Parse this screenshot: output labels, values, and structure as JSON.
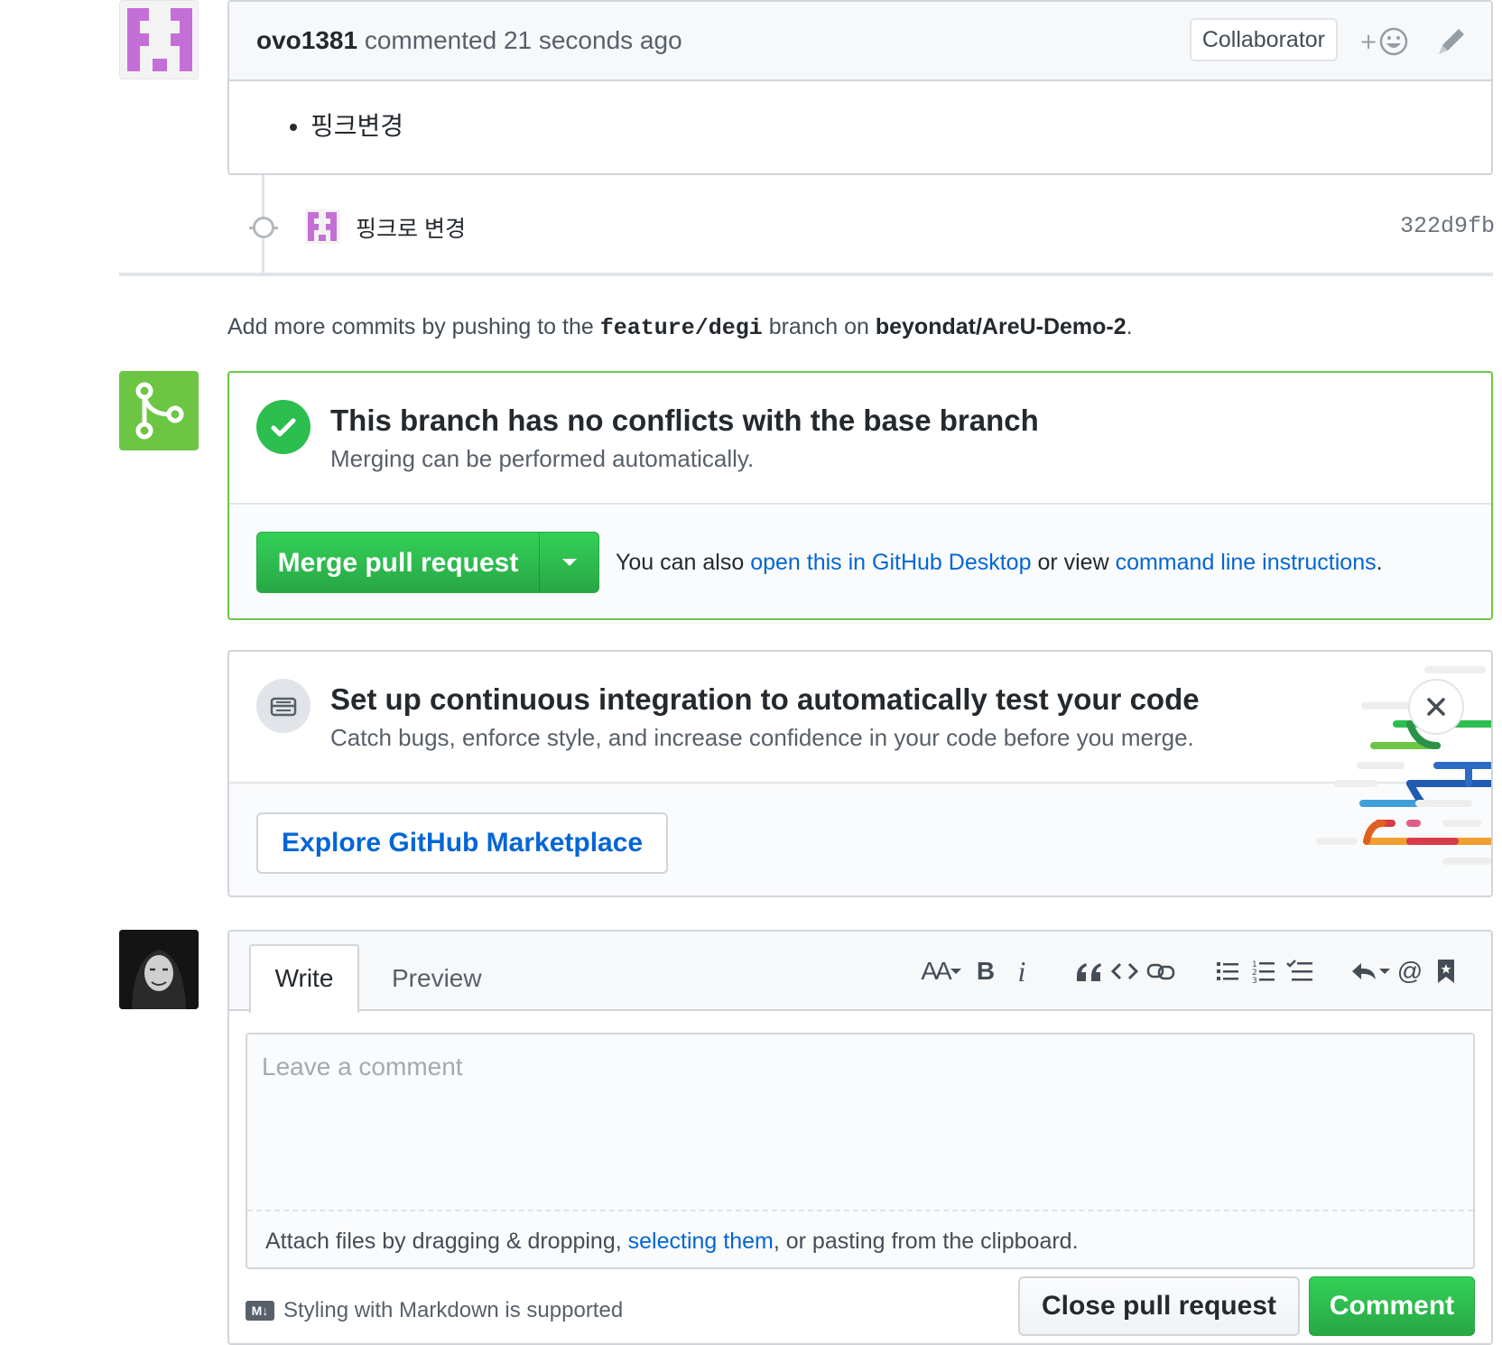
{
  "comment": {
    "author": "ovo1381",
    "action": "commented",
    "time": "21 seconds ago",
    "badge": "Collaborator",
    "body_items": [
      "핑크변경"
    ]
  },
  "commit": {
    "message": "핑크로  변경",
    "sha": "322d9fb"
  },
  "push_hint": {
    "prefix": "Add more commits by pushing to the",
    "branch": "feature/degi",
    "middle": "branch on",
    "repo": "beyondat/AreU-Demo-2",
    "suffix": "."
  },
  "merge": {
    "title": "This branch has no conflicts with the base branch",
    "subtitle": "Merging can be performed automatically.",
    "button_label": "Merge pull request",
    "alt_prefix": "You can also",
    "alt_link1": "open this in GitHub Desktop",
    "alt_middle": "or view",
    "alt_link2": "command line instructions",
    "alt_suffix": "."
  },
  "ci": {
    "title": "Set up continuous integration to automatically test your code",
    "subtitle": "Catch bugs, enforce style, and increase confidence in your code before you merge.",
    "button_label": "Explore GitHub Marketplace"
  },
  "form": {
    "tab_write": "Write",
    "tab_preview": "Preview",
    "toolbar": {
      "heading": "AA",
      "bold": "B",
      "italic": "i"
    },
    "placeholder": "Leave a comment",
    "attach_prefix": "Attach files by dragging & dropping,",
    "attach_link": "selecting them",
    "attach_suffix": ", or pasting from the clipboard.",
    "markdown_icon": "M↓",
    "markdown_note": "Styling with Markdown is supported",
    "close_button": "Close pull request",
    "comment_button": "Comment"
  },
  "colors": {
    "merge_green": "#6cc644",
    "check_green": "#2cbe4e",
    "link_blue": "#0366d6",
    "identicon_purple": "#c46fd6"
  }
}
